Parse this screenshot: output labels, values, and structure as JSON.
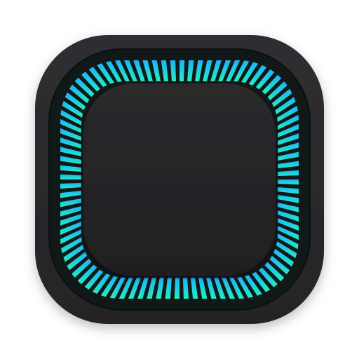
{
  "icon": {
    "name": "app-icon",
    "colors": {
      "background": "#ffffff",
      "tile_outer": "#2b2b2d",
      "tile_inner": "#1f1f21",
      "ring_track": "#0f1a18",
      "center_tile": "#232325",
      "gradient_top": "#1fb6ff",
      "gradient_bottom": "#22f0c4"
    },
    "ring": {
      "segment_count": 92
    }
  }
}
